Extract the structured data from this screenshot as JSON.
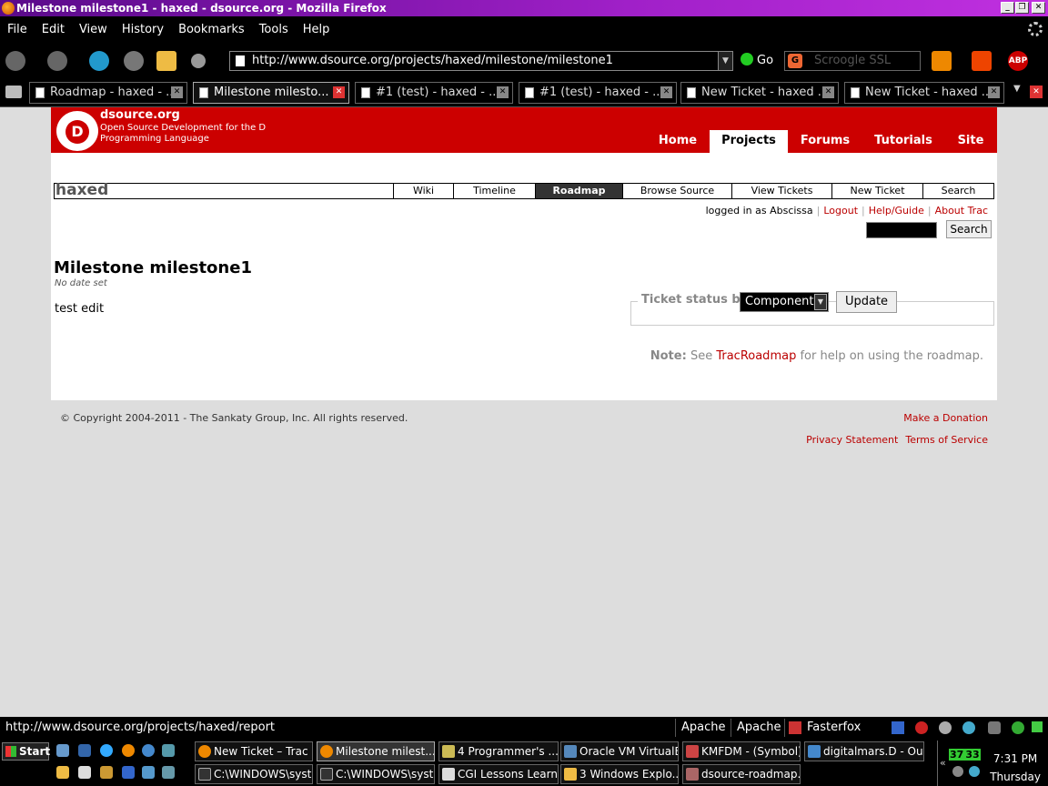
{
  "window": {
    "title": "Milestone milestone1 - haxed - dsource.org - Mozilla Firefox"
  },
  "menu": [
    "File",
    "Edit",
    "View",
    "History",
    "Bookmarks",
    "Tools",
    "Help"
  ],
  "address": {
    "url": "http://www.dsource.org/projects/haxed/milestone/milestone1",
    "go_label": "Go",
    "search_placeholder": "Scroogle SSL"
  },
  "tabs": [
    {
      "label": "Roadmap - haxed - ..."
    },
    {
      "label": "Milestone milesto..."
    },
    {
      "label": "#1 (test) - haxed - ..."
    },
    {
      "label": "#1 (test) - haxed - ..."
    },
    {
      "label": "New Ticket - haxed ..."
    },
    {
      "label": "New Ticket - haxed ..."
    }
  ],
  "site": {
    "name": "dsource.org",
    "tagline": "Open Source Development for the D Programming Language",
    "nav": [
      "Home",
      "Projects",
      "Forums",
      "Tutorials",
      "Site"
    ]
  },
  "trac": {
    "project": "haxed",
    "nav": [
      "Wiki",
      "Timeline",
      "Roadmap",
      "Browse Source",
      "View Tickets",
      "New Ticket",
      "Search"
    ],
    "logged_in": "logged in as Abscissa",
    "meta_links": [
      "Logout",
      "Help/Guide",
      "About Trac"
    ],
    "search_button": "Search"
  },
  "milestone": {
    "title": "Milestone milestone1",
    "date": "No date set",
    "description": "test edit",
    "status_legend": "Ticket status by",
    "status_select": "Component",
    "update_button": "Update",
    "note_label": "Note:",
    "note_pre": "See",
    "note_link": "TracRoadmap",
    "note_post": "for help on using the roadmap."
  },
  "footer": {
    "copyright": "© Copyright 2004-2011 - The Sankaty Group, Inc. All rights reserved.",
    "donate": "Make a Donation",
    "privacy": "Privacy Statement",
    "terms": "Terms of Service"
  },
  "status": {
    "url": "http://www.dsource.org/projects/haxed/report",
    "items": [
      "Apache",
      "Apache",
      "Fasterfox"
    ]
  },
  "taskbar": {
    "start": "Start",
    "row1": [
      "New Ticket – Trac ...",
      "Milestone milest...",
      "4 Programmer's ...",
      "Oracle VM VirtualB...",
      "KMFDM - (Symbol) ...",
      "digitalmars.D - Out..."
    ],
    "row2": [
      "C:\\WINDOWS\\syst...",
      "C:\\WINDOWS\\syst...",
      "CGI Lessons Learn...",
      "3 Windows Explo...",
      "dsource-roadmap...."
    ],
    "time": "7:31 PM",
    "day": "Thursday",
    "tray_a": "37",
    "tray_b": "33"
  }
}
